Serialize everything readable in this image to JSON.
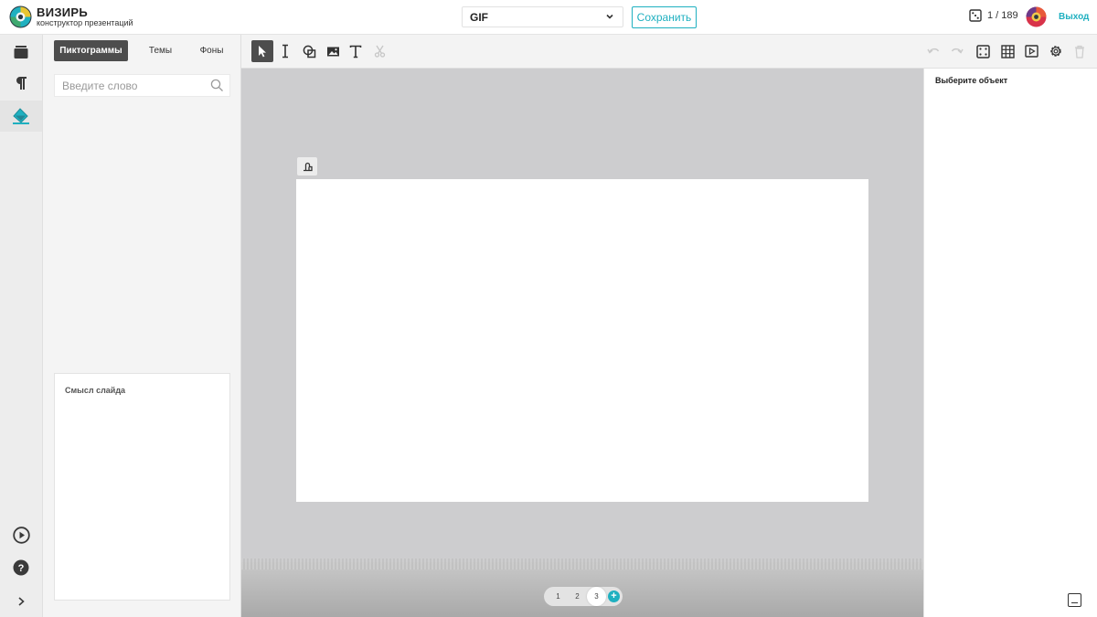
{
  "app": {
    "title": "ВИЗИРЬ",
    "subtitle": "конструктор презентаций",
    "accent_color": "#1fb0c0"
  },
  "header": {
    "format_select": {
      "value": "GIF"
    },
    "save_label": "Сохранить",
    "counter": "1 / 189",
    "exit_label": "Выход"
  },
  "rail": {
    "items": [
      {
        "icon": "layers-icon"
      },
      {
        "icon": "paragraph-icon"
      },
      {
        "icon": "paint-bucket-icon",
        "active": true
      },
      {
        "icon": "play-circle-icon"
      },
      {
        "icon": "help-icon"
      },
      {
        "icon": "chevron-right-icon"
      }
    ]
  },
  "left_panel": {
    "tabs": [
      {
        "label": "Пиктограммы",
        "active": true
      },
      {
        "label": "Темы"
      },
      {
        "label": "Фоны"
      }
    ],
    "search_placeholder": "Введите слово",
    "meaning_title": "Смысл слайда"
  },
  "toolbar": {
    "tools": [
      "pointer-icon",
      "text-cursor-icon",
      "shapes-icon",
      "image-icon",
      "text-icon",
      "scissors-icon"
    ],
    "actions": [
      "undo-icon",
      "redo-icon",
      "dice-icon",
      "grid-icon",
      "preview-icon",
      "settings-icon",
      "trash-icon"
    ]
  },
  "pager": {
    "pages": [
      "1",
      "2",
      "3"
    ],
    "current": "3",
    "add_label": "+"
  },
  "right_panel": {
    "title": "Выберите объект"
  }
}
